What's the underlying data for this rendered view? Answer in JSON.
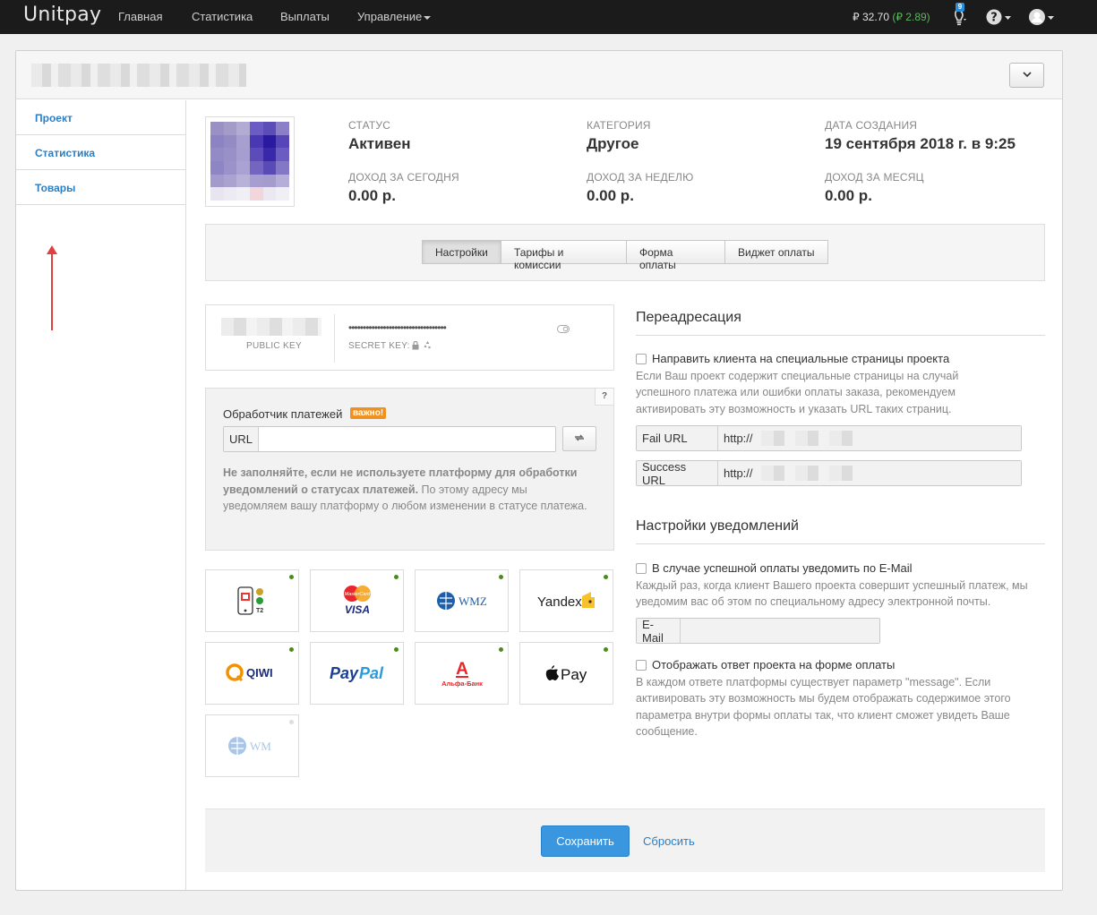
{
  "nav": {
    "logo": "Unitpay",
    "items": [
      "Главная",
      "Статистика",
      "Выплаты",
      "Управление"
    ],
    "balance_main": "₽ 32.70",
    "balance_extra": "(₽ 2.89)",
    "notifications_count": "9"
  },
  "sidebar": {
    "items": [
      "Проект",
      "Статистика",
      "Товары"
    ]
  },
  "stats": [
    {
      "label": "Статус",
      "value": "Активен"
    },
    {
      "label": "Категория",
      "value": "Другое"
    },
    {
      "label": "Дата создания",
      "value": "19 сентября 2018 г. в 9:25"
    },
    {
      "label": "Доход за сегодня",
      "value": "0.00 р."
    },
    {
      "label": "Доход за неделю",
      "value": "0.00 р."
    },
    {
      "label": "Доход за месяц",
      "value": "0.00 р."
    }
  ],
  "tabs": [
    "Настройки",
    "Тарифы и комиссии",
    "Форма оплаты",
    "Виджет оплаты"
  ],
  "keys": {
    "public_label": "PUBLIC KEY",
    "secret_dots": "••••••••••••••••••••••••••••••••••",
    "secret_label": "SECRET KEY:"
  },
  "handler": {
    "help": "?",
    "title": "Обработчик платежей",
    "badge": "важно!",
    "url_addon": "URL",
    "url_value": "",
    "note_bold": "Не заполняйте, если не используете платформу для обработки уведомлений о статусах платежей.",
    "note_rest": " По этому адресу мы уведомляем вашу платформу о любом изменении в статусе платежа."
  },
  "payment_methods": [
    {
      "name": "T2 / МТС / Билайн / МегаФон",
      "enabled": true
    },
    {
      "name": "MasterCard VISA",
      "enabled": true
    },
    {
      "name": "WMZ",
      "enabled": true
    },
    {
      "name": "Yandex",
      "enabled": true
    },
    {
      "name": "QIWI",
      "enabled": true
    },
    {
      "name": "PayPal",
      "enabled": true
    },
    {
      "name": "Альфа-Банк",
      "enabled": true
    },
    {
      "name": "Apple Pay",
      "enabled": true
    },
    {
      "name": "WM",
      "enabled": false
    }
  ],
  "redirect": {
    "title": "Переадресация",
    "checkbox": "Направить клиента на специальные страницы проекта",
    "help": "Если Ваш проект содержит специальные страницы на случай успешного платежа или ошибки оплаты заказа, рекомендуем активировать эту возможность и указать URL таких страниц.",
    "fail_label": "Fail URL",
    "fail_value": "http://",
    "success_label": "Success URL",
    "success_value": "http://"
  },
  "notifications": {
    "title": "Настройки уведомлений",
    "email_checkbox": "В случае успешной оплаты уведомить по E-Mail",
    "email_help": "Каждый раз, когда клиент Вашего проекта совершит успешный платеж, мы уведомим вас об этом по специальному адресу электронной почты.",
    "email_label": "E-Mail",
    "email_value": "",
    "response_checkbox": "Отображать ответ проекта на форме оплаты",
    "response_help": "В каждом ответе платформы существует параметр \"message\". Если активировать эту возможность мы будем отображать содержимое этого параметра внутри формы оплаты так, что клиент сможет увидеть Ваше сообщение."
  },
  "actions": {
    "save": "Сохранить",
    "reset": "Сбросить"
  },
  "colors": {
    "accent": "#3a97df",
    "link": "#2a7fc4",
    "badge": "#f0901e",
    "active_dot": "#4a8c1c"
  }
}
